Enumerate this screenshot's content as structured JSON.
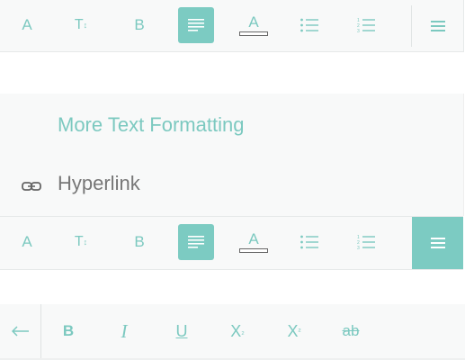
{
  "toolbar_top": {
    "buttons": [
      {
        "icon": "font-color-a-icon",
        "label": "A"
      },
      {
        "icon": "text-size-icon",
        "label": "T",
        "sub": "↕"
      },
      {
        "icon": "bold-icon",
        "label": "B"
      },
      {
        "icon": "align-left-icon",
        "active": true
      },
      {
        "icon": "text-highlight-icon",
        "label": "A"
      },
      {
        "icon": "bullet-list-icon"
      },
      {
        "icon": "numbered-list-icon"
      }
    ],
    "menu_icon": "hamburger-menu-icon"
  },
  "panel": {
    "more_text": "More Text Formatting",
    "hyperlink": "Hyperlink",
    "link_icon": "link-icon"
  },
  "toolbar_bottom": {
    "buttons": [
      {
        "label": "A"
      },
      {
        "label": "T",
        "sub": "↕"
      },
      {
        "label": "B"
      },
      {
        "active": true
      },
      {
        "label": "A"
      },
      {},
      {}
    ],
    "menu_active": true
  },
  "format_bar": {
    "back_icon": "back-arrow-icon",
    "bold": "B",
    "italic": "I",
    "underline": "U",
    "subscript": "X",
    "subscript_mark": "₂",
    "superscript": "X",
    "superscript_mark": "²",
    "strikethrough": "ab"
  },
  "colors": {
    "accent": "#7ccbc2",
    "toolbar_bg": "#f8f9f9",
    "muted_text": "#777777"
  }
}
